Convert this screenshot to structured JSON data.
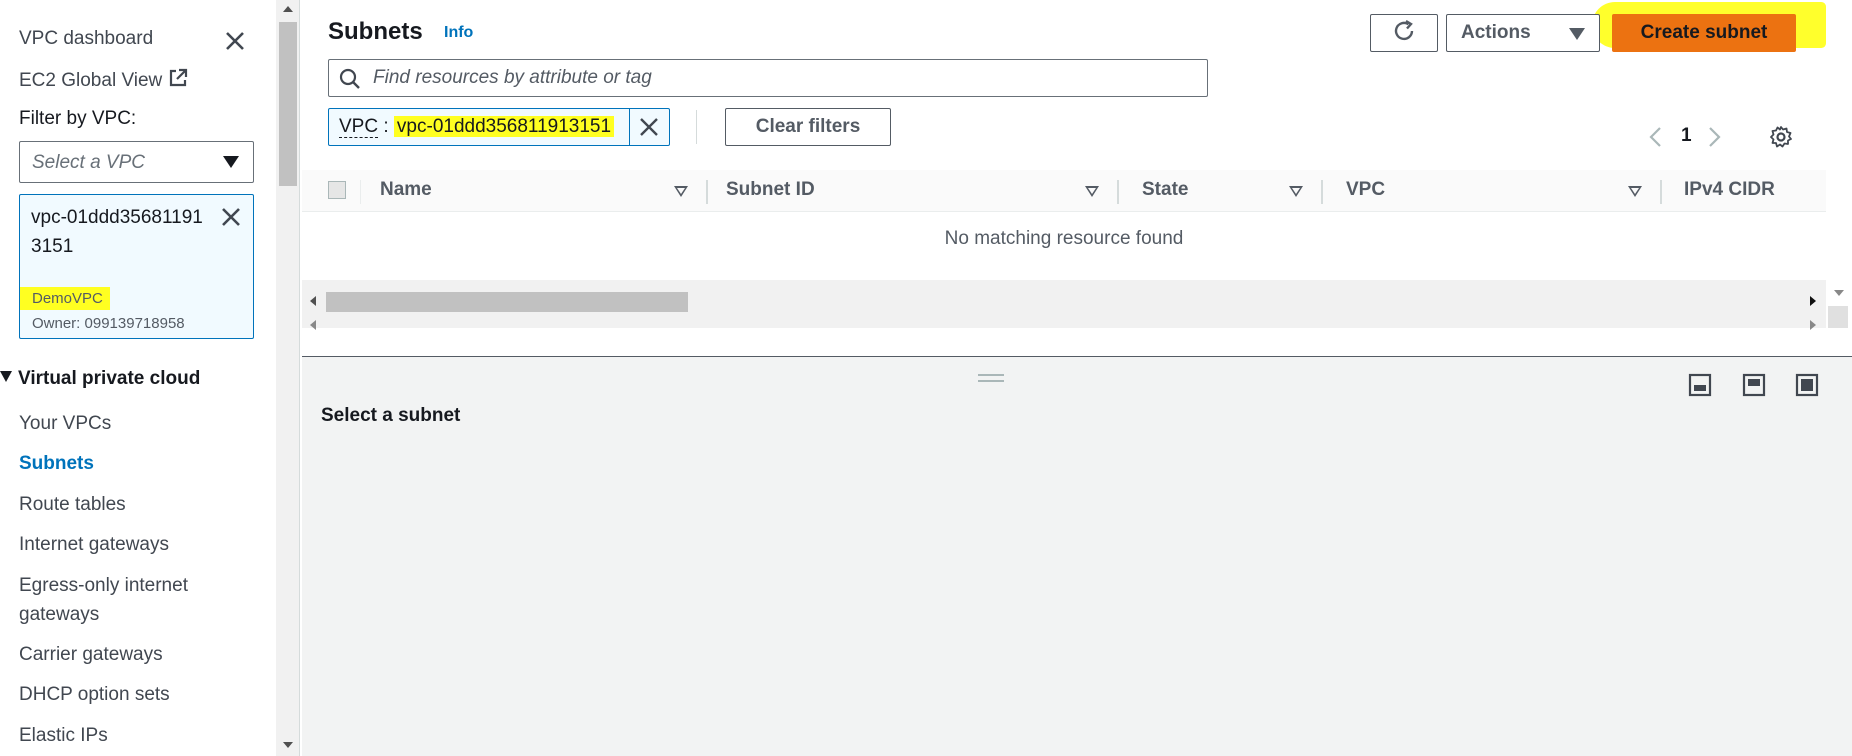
{
  "sidebar": {
    "dashboard_link": "VPC dashboard",
    "ec2_global_view": "EC2 Global View",
    "filter_label": "Filter by VPC:",
    "select_placeholder": "Select a VPC",
    "selected_vpc": {
      "id": "vpc-01ddd356811913151",
      "name": "DemoVPC",
      "owner": "Owner: 099139718958"
    },
    "section_title": "Virtual private cloud",
    "nav_items": [
      {
        "label": "Your VPCs",
        "active": false
      },
      {
        "label": "Subnets",
        "active": true
      },
      {
        "label": "Route tables",
        "active": false
      },
      {
        "label": "Internet gateways",
        "active": false
      },
      {
        "label": "Egress-only internet gateways",
        "active": false
      },
      {
        "label": "Carrier gateways",
        "active": false
      },
      {
        "label": "DHCP option sets",
        "active": false
      },
      {
        "label": "Elastic IPs",
        "active": false
      }
    ]
  },
  "main": {
    "title": "Subnets",
    "info": "Info",
    "actions_label": "Actions",
    "create_label": "Create subnet",
    "search_placeholder": "Find resources by attribute or tag",
    "filter": {
      "key": "VPC",
      "separator": ":",
      "value": "vpc-01ddd356811913151"
    },
    "clear_filters": "Clear filters",
    "page_number": "1",
    "columns": [
      "Name",
      "Subnet ID",
      "State",
      "VPC",
      "IPv4 CIDR"
    ],
    "empty_message": "No matching resource found"
  },
  "split_panel": {
    "title": "Select a subnet"
  },
  "colors": {
    "accent": "#0073bb",
    "primary_button": "#ec7211",
    "highlight": "#ffff21"
  }
}
